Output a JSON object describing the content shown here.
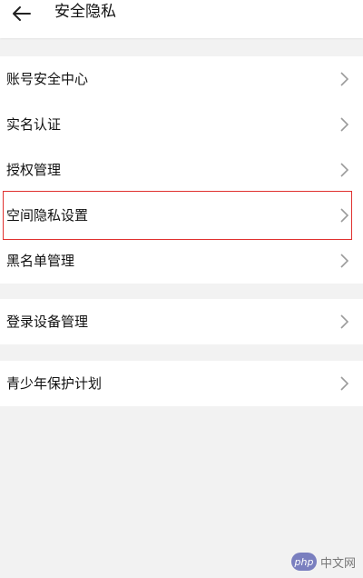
{
  "header": {
    "back_icon": "arrow-left-icon",
    "title": "安全隐私"
  },
  "groups": [
    {
      "items": [
        {
          "label": "账号安全中心",
          "icon": "chevron-right-icon"
        },
        {
          "label": "实名认证",
          "icon": "chevron-right-icon"
        },
        {
          "label": "授权管理",
          "icon": "chevron-right-icon"
        },
        {
          "label": "空间隐私设置",
          "icon": "chevron-right-icon",
          "highlighted": true
        },
        {
          "label": "黑名单管理",
          "icon": "chevron-right-icon"
        }
      ]
    },
    {
      "items": [
        {
          "label": "登录设备管理",
          "icon": "chevron-right-icon"
        }
      ]
    },
    {
      "items": [
        {
          "label": "青少年保护计划",
          "icon": "chevron-right-icon"
        }
      ]
    }
  ],
  "watermark": {
    "logo_text": "php",
    "text": "中文网"
  },
  "colors": {
    "background": "#f2f2f2",
    "surface": "#ffffff",
    "highlight_border": "#e0312f",
    "chevron": "#9a9a9a"
  }
}
